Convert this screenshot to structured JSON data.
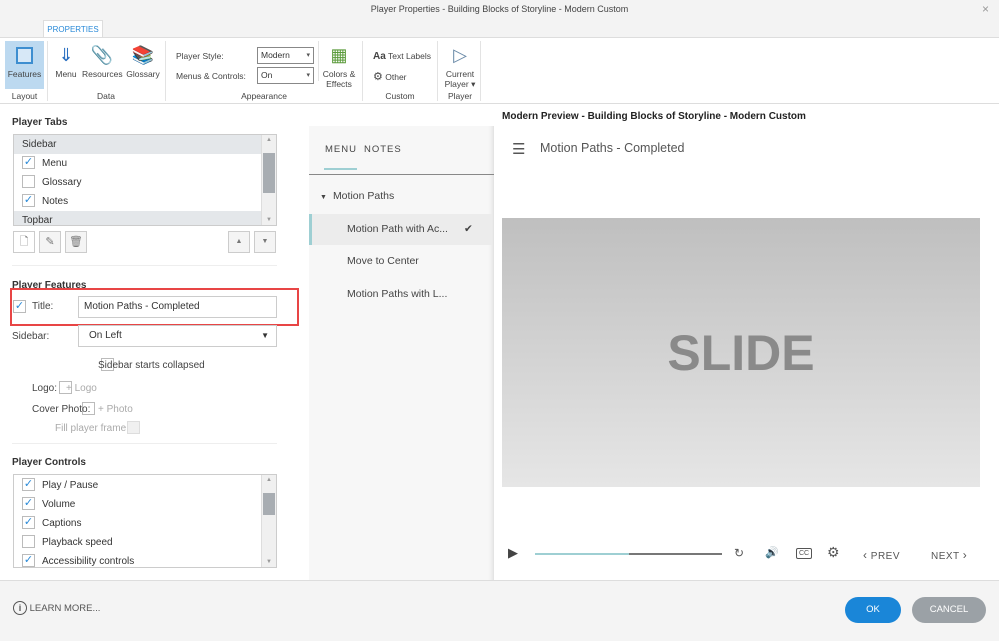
{
  "window": {
    "title": "Player Properties - Building Blocks of Storyline - Modern Custom",
    "close": "×"
  },
  "ribbon": {
    "tab": "PROPERTIES",
    "features": "Features",
    "menu": "Menu",
    "resources": "Resources",
    "glossary": "Glossary",
    "player_style_label": "Player Style:",
    "player_style_value": "Modern",
    "menus_controls_label": "Menus & Controls:",
    "menus_controls_value": "On",
    "colors_effects": [
      "Colors &",
      "Effects"
    ],
    "text_labels": "Text Labels",
    "text_labels_icon": "Aa",
    "other": "Other",
    "current_player": [
      "Current",
      "Player ▾"
    ],
    "groups": {
      "layout": "Layout",
      "data": "Data",
      "appearance": "Appearance",
      "custom": "Custom",
      "player": "Player"
    }
  },
  "player_tabs": {
    "heading": "Player Tabs",
    "items": [
      {
        "label": "Sidebar",
        "type": "header"
      },
      {
        "label": "Menu",
        "checked": true
      },
      {
        "label": "Glossary",
        "checked": false
      },
      {
        "label": "Notes",
        "checked": true
      },
      {
        "label": "Topbar",
        "type": "header"
      }
    ]
  },
  "player_features": {
    "heading": "Player Features",
    "title_label": "Title:",
    "title_value": "Motion Paths - Completed",
    "title_checked": true,
    "sidebar_label": "Sidebar:",
    "sidebar_value": "On Left",
    "sidebar_collapsed": "Sidebar starts collapsed",
    "logo_label": "Logo:",
    "logo_add": "+ Logo",
    "cover_label": "Cover Photo:",
    "cover_add": "+ Photo",
    "fill_frame": "Fill player frame"
  },
  "player_controls": {
    "heading": "Player Controls",
    "items": [
      {
        "label": "Play / Pause",
        "checked": true
      },
      {
        "label": "Volume",
        "checked": true
      },
      {
        "label": "Captions",
        "checked": true
      },
      {
        "label": "Playback speed",
        "checked": false
      },
      {
        "label": "Accessibility controls",
        "checked": true
      }
    ]
  },
  "preview": {
    "heading": "Modern Preview - Building Blocks of Storyline - Modern Custom",
    "tabs": [
      "MENU",
      "NOTES"
    ],
    "section": "Motion Paths",
    "items": [
      {
        "label": "Motion Path with Ac...",
        "active": true,
        "visited": "✔"
      },
      {
        "label": "Move to Center"
      },
      {
        "label": "Motion Paths with L..."
      }
    ],
    "title": "Motion Paths - Completed",
    "slide_text": "SLIDE",
    "progress": 0.5,
    "prev": "PREV",
    "next": "NEXT",
    "cc": "CC",
    "accent": "#9ecfd3"
  },
  "footer": {
    "learn_more": "LEARN MORE...",
    "ok": "OK",
    "cancel": "CANCEL",
    "ok_color": "#1a86d8",
    "cancel_color": "#9ba1a6"
  }
}
